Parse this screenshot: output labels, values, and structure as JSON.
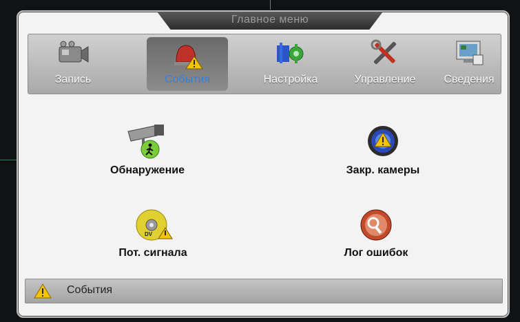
{
  "window": {
    "title": "Главное меню"
  },
  "tabs": [
    {
      "label": "Запись",
      "icon": "camcorder-icon",
      "active": false
    },
    {
      "label": "События",
      "icon": "alarm-warning-icon",
      "active": true
    },
    {
      "label": "Настройка",
      "icon": "gears-icon",
      "active": false
    },
    {
      "label": "Управление",
      "icon": "tools-icon",
      "active": false
    },
    {
      "label": "Сведения",
      "icon": "info-screen-icon",
      "active": false
    }
  ],
  "items": [
    {
      "label": "Обнаружение",
      "icon": "motion-camera-icon"
    },
    {
      "label": "Закр. камеры",
      "icon": "camera-blind-icon"
    },
    {
      "label": "Пот. сигнала",
      "icon": "video-loss-icon"
    },
    {
      "label": "Лог ошибок",
      "icon": "error-log-icon"
    }
  ],
  "status": {
    "text": "События",
    "icon": "warning-icon"
  },
  "colors": {
    "active_tab_text": "#3a7fd4",
    "warning": "#f5c400"
  }
}
